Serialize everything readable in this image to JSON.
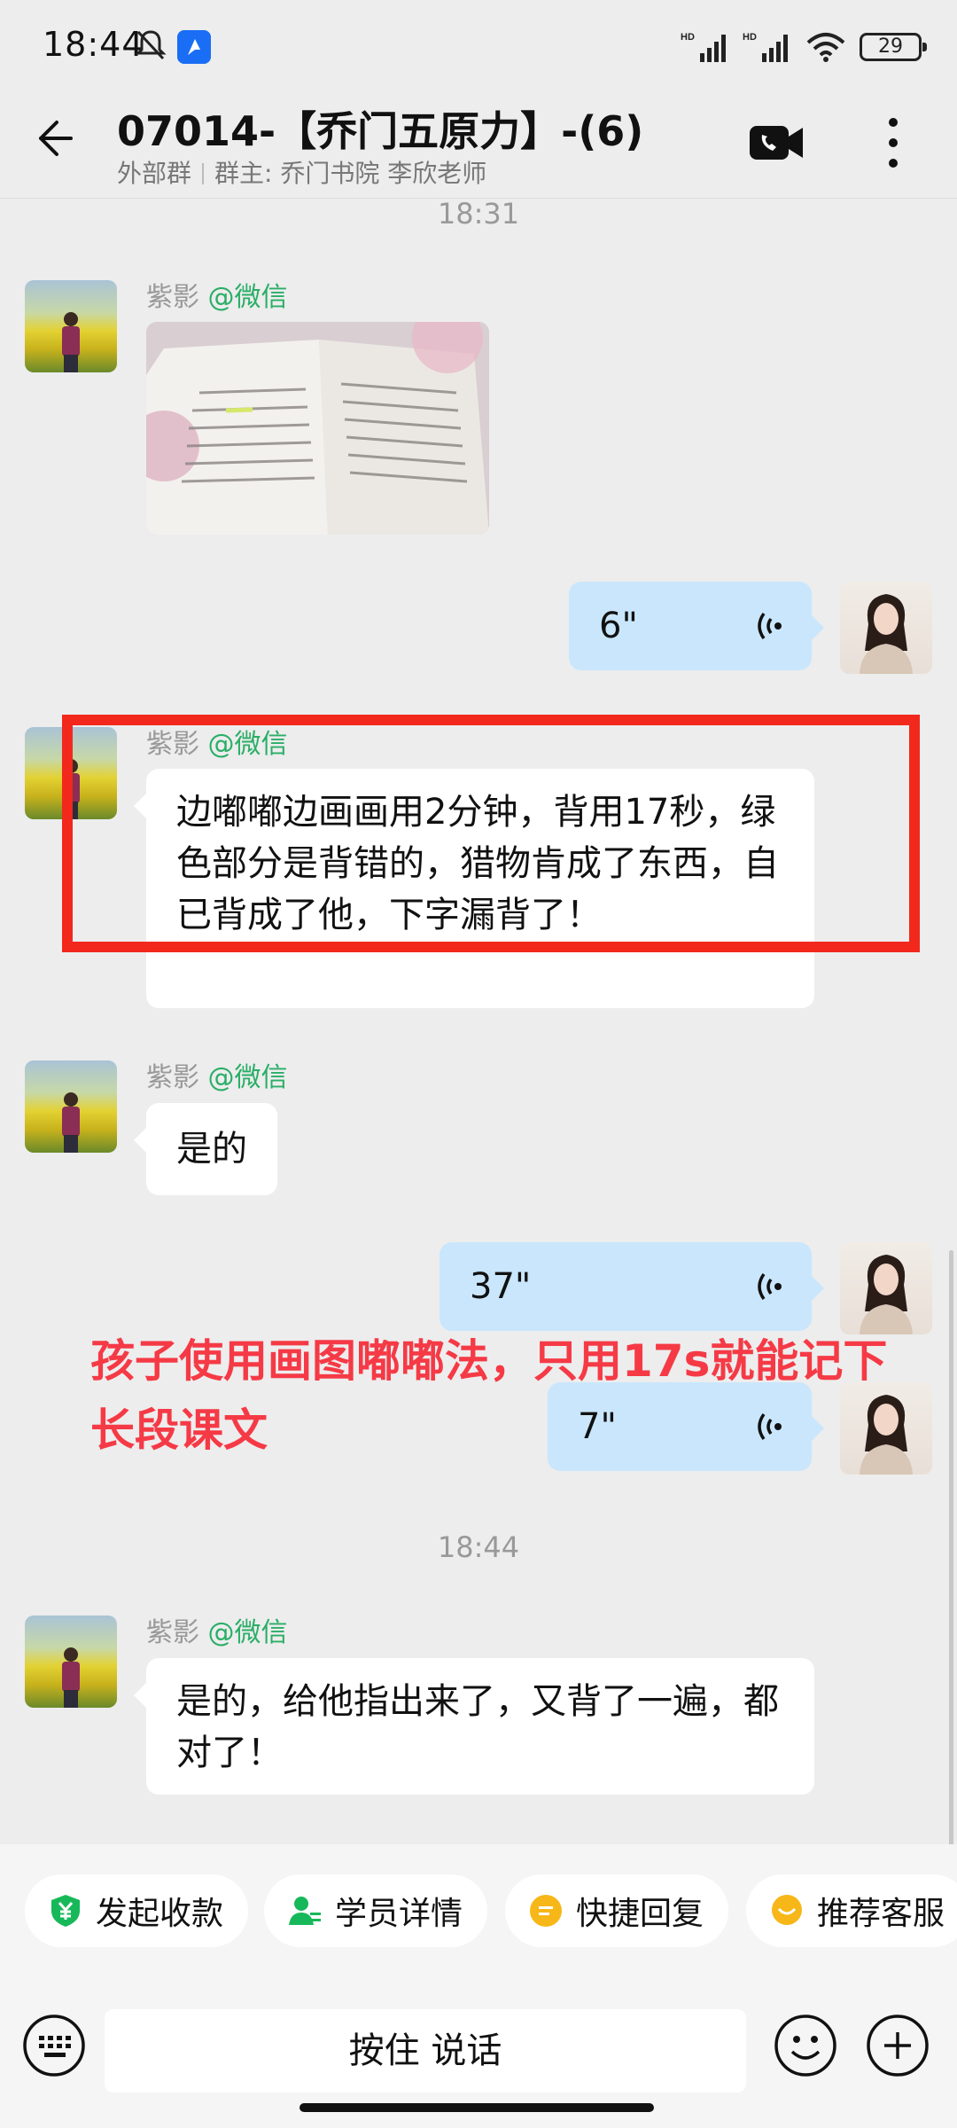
{
  "status_bar": {
    "time": "18:44",
    "network_1": "HD",
    "network_2": "HD",
    "battery": "29",
    "icons": [
      "mute-bell-icon",
      "app-notification-icon",
      "signal-icon",
      "wifi-icon",
      "battery-icon"
    ]
  },
  "header": {
    "title": "07014-【乔门五原力】-(6)",
    "group_type": "外部群",
    "group_owner": "群主: 乔门书院 李欣老师",
    "icons": [
      "back-arrow-icon",
      "video-call-icon",
      "more-vertical-icon"
    ]
  },
  "messages": {
    "time_1": "18:31",
    "time_2": "18:44",
    "sender_name": "紫影",
    "sender_source": "@微信",
    "voice_1": "6\"",
    "text_1": "边嘟嘟边画画用2分钟，背用17秒，绿色部分是背错的，猎物肯成了东西，自已背成了他，下字漏背了！",
    "text_2": "是的",
    "voice_2": "37\"",
    "voice_3": "7\"",
    "text_3": "是的，给他指出来了，又背了一遍，都对了！"
  },
  "overlay_caption": "孩子使用画图嘟嘟法，只用17s就能记下长段课文",
  "quick_actions": {
    "collect": "发起收款",
    "student": "学员详情",
    "quick_reply": "快捷回复",
    "recommend": "推荐客服"
  },
  "input_bar": {
    "hold_to_talk": "按住 说话",
    "icons": [
      "keyboard-icon",
      "emoji-icon",
      "plus-icon"
    ]
  },
  "colors": {
    "background": "#ededed",
    "voice_bubble": "#c9e6fc",
    "source_green": "#2aae67",
    "highlight_red": "#f2281c",
    "caption_red": "#f53a46"
  }
}
